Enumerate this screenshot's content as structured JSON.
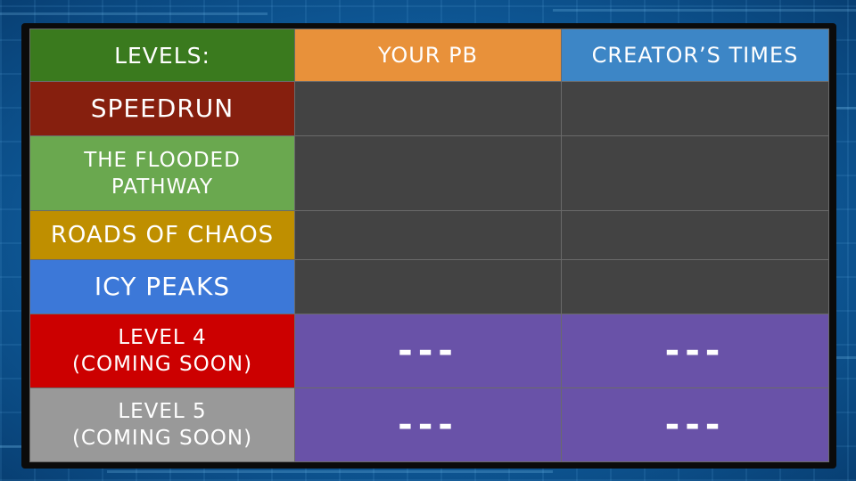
{
  "header": {
    "levels_label": "LEVELS:",
    "pb_label": "YOUR PB",
    "creator_label": "CREATOR’S TIMES"
  },
  "colors": {
    "header_levels": "#3a7a1e",
    "header_pb": "#e8913a",
    "header_creator": "#3d86c6",
    "speedrun": "#861f0e",
    "flooded": "#6aa84f",
    "chaos": "#bf8f00",
    "icy": "#3c78d8",
    "level4": "#cc0000",
    "level5": "#999999",
    "time_cell": "#434343",
    "coming_soon_cell": "#6952a8"
  },
  "rows": [
    {
      "name": "SPEEDRUN",
      "pb": "",
      "creator": ""
    },
    {
      "name_line1": "THE FLOODED",
      "name_line2": "PATHWAY",
      "pb": "",
      "creator": ""
    },
    {
      "name": "ROADS OF CHAOS",
      "pb": "",
      "creator": ""
    },
    {
      "name": "ICY PEAKS",
      "pb": "",
      "creator": ""
    },
    {
      "name_line1": "LEVEL 4",
      "name_line2": "(COMING SOON)",
      "pb": "---",
      "creator": "---"
    },
    {
      "name_line1": "LEVEL 5",
      "name_line2": "(COMING SOON)",
      "pb": "---",
      "creator": "---"
    }
  ]
}
